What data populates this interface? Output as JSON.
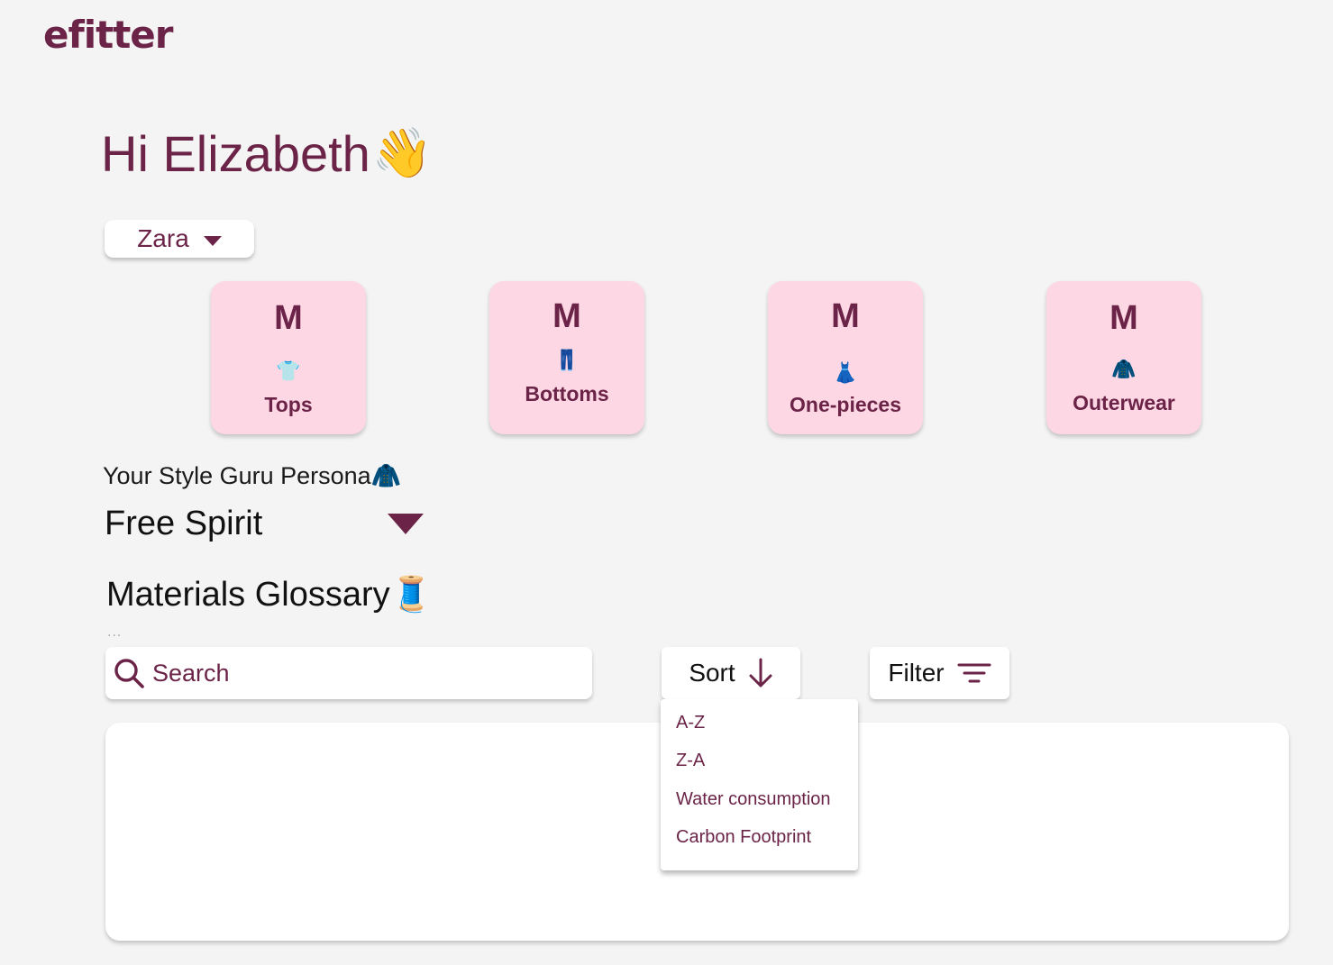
{
  "app": {
    "logo": "efitter"
  },
  "greeting": {
    "text": "Hi Elizabeth",
    "emoji": "👋"
  },
  "brand_select": {
    "value": "Zara",
    "icon": "caret-down-icon"
  },
  "size_cards": [
    {
      "size": "M",
      "emoji": "👕",
      "category": "Tops"
    },
    {
      "size": "M",
      "emoji": "👖",
      "category": "Bottoms"
    },
    {
      "size": "M",
      "emoji": "👗",
      "category": "One-pieces"
    },
    {
      "size": "M",
      "emoji": "🧥",
      "category": "Outerwear"
    }
  ],
  "persona": {
    "label": "Your Style Guru Persona",
    "emoji": "🧥",
    "value": "Free Spirit"
  },
  "glossary": {
    "title": "Materials Glossary",
    "emoji": "🧵",
    "dots": "...",
    "search_placeholder": "Search",
    "sort_label": "Sort",
    "filter_label": "Filter",
    "sort_options": [
      "A-Z",
      "Z-A",
      "Water consumption",
      "Carbon Footprint"
    ]
  },
  "colors": {
    "accent": "#6b2447",
    "card_background": "#fdd7e4",
    "page_background": "#f4f4f4"
  }
}
